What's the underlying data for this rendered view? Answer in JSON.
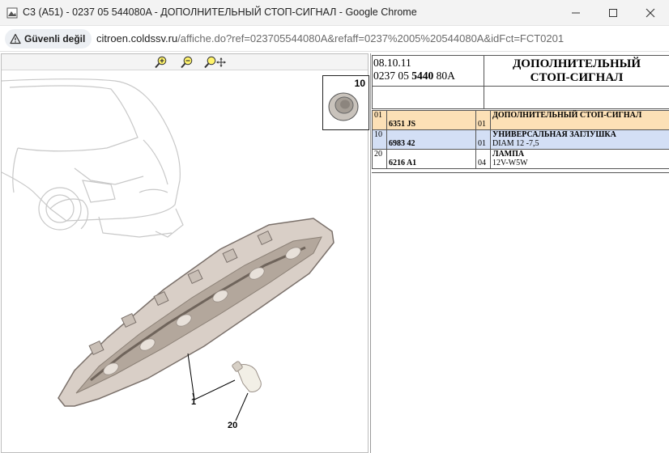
{
  "window": {
    "title": "C3 (A51) - 0237 05 544080A - ДОПОЛНИТЕЛЬНЫЙ СТОП-СИГНАЛ - Google Chrome",
    "app_icon": "page-icon"
  },
  "controls": {
    "minimize": "minimize-icon",
    "maximize": "maximize-icon",
    "close": "close-icon"
  },
  "address": {
    "security_label": "Güvenli değil",
    "security_icon": "warning-icon",
    "url_domain": "citroen.coldssv.ru",
    "url_path": "/affiche.do?ref=023705544080A&refaff=0237%2005%20544080A&idFct=FCT0201"
  },
  "viewer": {
    "zoom_in_icon": "zoom-in-icon",
    "zoom_out_icon": "zoom-out-icon",
    "pan_icon": "zoom-pan-icon",
    "inset_number": "10",
    "callouts": [
      {
        "id": "callout-1",
        "text": "1"
      },
      {
        "id": "callout-20",
        "text": "20"
      }
    ]
  },
  "header": {
    "date": "08.10.11",
    "ref_prefix": "0237 05 ",
    "ref_bold": "5440",
    "ref_suffix": " 80A",
    "title_line1": "ДОПОЛНИТЕЛЬНЫЙ",
    "title_line2": "СТОП-СИГНАЛ"
  },
  "parts": [
    {
      "ref": "01",
      "part_no": "6351 JS",
      "qty": "01",
      "name": "ДОПОЛНИТЕЛЬНЫЙ СТОП-СИГНАЛ",
      "detail": ""
    },
    {
      "ref": "10",
      "part_no": "6983 42",
      "qty": "01",
      "name": "УНИВЕРСАЛЬНАЯ ЗАГЛУШКА",
      "detail": "DIAM 12 -7,5"
    },
    {
      "ref": "20",
      "part_no": "6216 A1",
      "qty": "04",
      "name": "ЛАМПА",
      "detail": "12V-W5W"
    }
  ],
  "colors": {
    "highlight_row": "#fce0b6",
    "selected_row": "#d3dff5"
  }
}
